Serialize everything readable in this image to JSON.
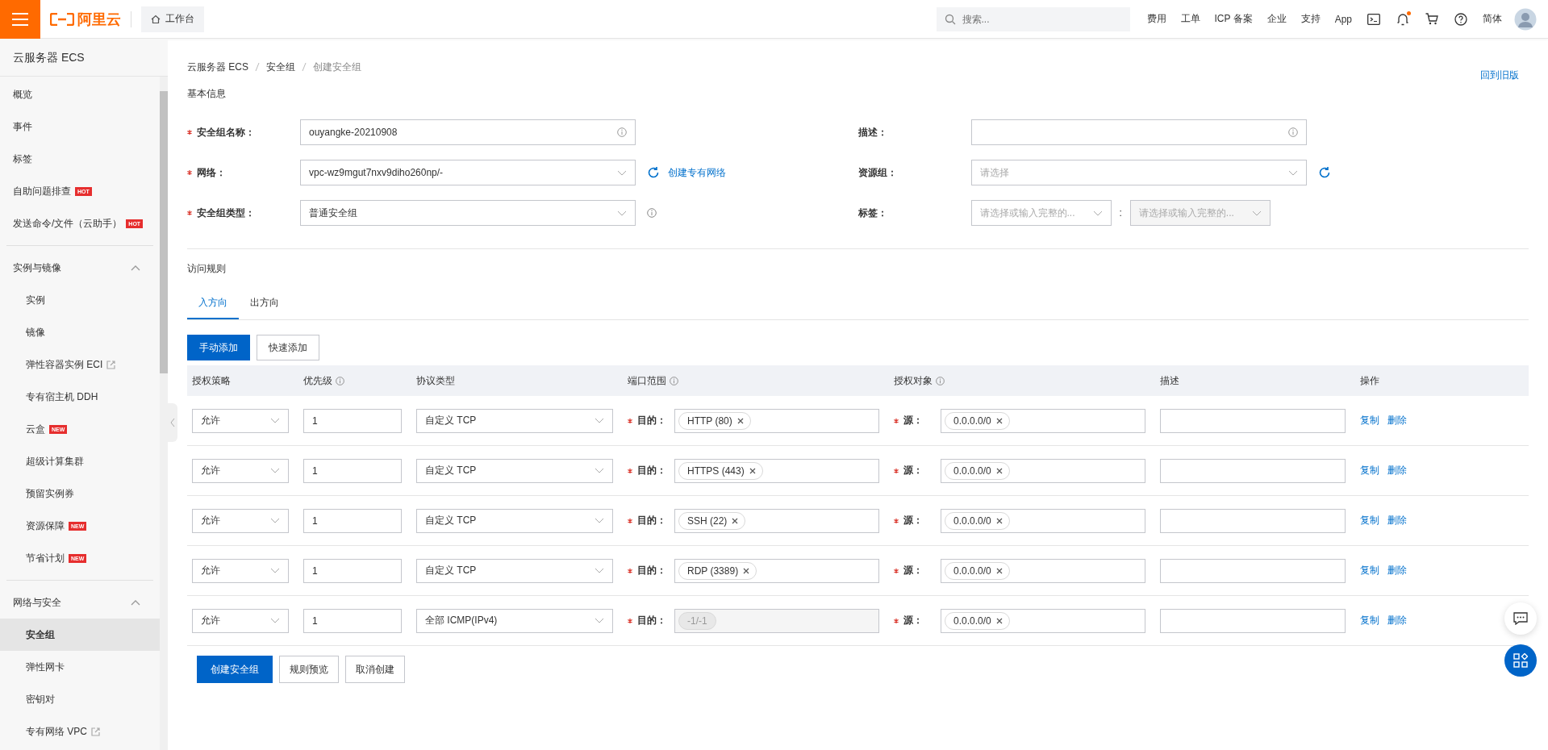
{
  "topbar": {
    "logo": "阿里云",
    "workbench": "工作台",
    "search": {
      "placeholder": "搜索..."
    },
    "links": [
      "费用",
      "工单",
      "ICP 备案",
      "企业",
      "支持",
      "App"
    ],
    "bell_unread": true,
    "language": "简体"
  },
  "sidebar": {
    "title": "云服务器 ECS",
    "items": [
      {
        "label": "概览",
        "selected": false
      },
      {
        "label": "事件",
        "selected": false
      },
      {
        "label": "标签",
        "selected": false
      },
      {
        "label": "自助问题排查",
        "badge": "HOT",
        "selected": false
      },
      {
        "label": "发送命令/文件（云助手）",
        "badge": "HOT",
        "selected": false
      }
    ],
    "groups": [
      {
        "label": "实例与镜像",
        "expanded": true,
        "items": [
          {
            "label": "实例",
            "selected": false
          },
          {
            "label": "镜像",
            "selected": false
          },
          {
            "label": "弹性容器实例 ECI",
            "external": true,
            "selected": false
          },
          {
            "label": "专有宿主机 DDH",
            "selected": false
          },
          {
            "label": "云盒",
            "badge": "NEW",
            "selected": false
          },
          {
            "label": "超级计算集群",
            "selected": false
          },
          {
            "label": "预留实例券",
            "selected": false
          },
          {
            "label": "资源保障",
            "badge": "NEW",
            "selected": false
          },
          {
            "label": "节省计划",
            "badge": "NEW",
            "selected": false
          }
        ]
      },
      {
        "label": "网络与安全",
        "expanded": true,
        "items": [
          {
            "label": "安全组",
            "selected": true
          },
          {
            "label": "弹性网卡",
            "selected": false
          },
          {
            "label": "密钥对",
            "selected": false
          },
          {
            "label": "专有网络 VPC",
            "external": true,
            "selected": false
          }
        ]
      }
    ]
  },
  "breadcrumb": [
    "云服务器 ECS",
    "安全组",
    "创建安全组"
  ],
  "old_version_link": "回到旧版",
  "basic_info": {
    "title": "基本信息",
    "left_fields": [
      {
        "kind": "text",
        "label": "安全组名称：",
        "required": true,
        "value": "ouyangke-20210908",
        "info": true
      },
      {
        "kind": "select",
        "label": "网络：",
        "required": true,
        "value": "vpc-wz9mgut7nxv9diho260np/-",
        "refresh": true,
        "link": "创建专有网络"
      },
      {
        "kind": "select",
        "label": "安全组类型：",
        "required": true,
        "value": "普通安全组",
        "info": true
      }
    ],
    "right_fields": [
      {
        "kind": "text",
        "label": "描述：",
        "required": false,
        "info": true
      },
      {
        "kind": "select",
        "label": "资源组：",
        "required": false,
        "placeholder": "请选择",
        "refresh": true
      },
      {
        "kind": "tags",
        "label": "标签：",
        "required": false,
        "key_placeholder": "请选择或输入完整的...",
        "value_placeholder": "请选择或输入完整的...",
        "separator": ":"
      }
    ]
  },
  "rules": {
    "title": "访问规则",
    "tabs": [
      {
        "label": "入方向",
        "selected": true
      },
      {
        "label": "出方向",
        "selected": false
      }
    ],
    "buttons": [
      {
        "label": "手动添加",
        "primary": true
      },
      {
        "label": "快速添加",
        "primary": false
      }
    ],
    "columns": [
      {
        "label": "授权策略",
        "info": false
      },
      {
        "label": "优先级",
        "info": true
      },
      {
        "label": "协议类型",
        "info": false
      },
      {
        "label": "端口范围",
        "info": true
      },
      {
        "label": "授权对象",
        "info": true
      },
      {
        "label": "描述",
        "info": false
      },
      {
        "label": "操作",
        "info": false
      }
    ],
    "rows": [
      {
        "policy": "允许",
        "priority": "1",
        "protocol": "自定义 TCP",
        "dest_label": "目的：",
        "dest_tag": "HTTP (80)",
        "dest_disabled": false,
        "src_label": "源：",
        "src_tag": "0.0.0.0/0",
        "actions": [
          "复制",
          "删除"
        ]
      },
      {
        "policy": "允许",
        "priority": "1",
        "protocol": "自定义 TCP",
        "dest_label": "目的：",
        "dest_tag": "HTTPS (443)",
        "dest_disabled": false,
        "src_label": "源：",
        "src_tag": "0.0.0.0/0",
        "actions": [
          "复制",
          "删除"
        ]
      },
      {
        "policy": "允许",
        "priority": "1",
        "protocol": "自定义 TCP",
        "dest_label": "目的：",
        "dest_tag": "SSH (22)",
        "dest_disabled": false,
        "src_label": "源：",
        "src_tag": "0.0.0.0/0",
        "actions": [
          "复制",
          "删除"
        ]
      },
      {
        "policy": "允许",
        "priority": "1",
        "protocol": "自定义 TCP",
        "dest_label": "目的：",
        "dest_tag": "RDP (3389)",
        "dest_disabled": false,
        "src_label": "源：",
        "src_tag": "0.0.0.0/0",
        "actions": [
          "复制",
          "删除"
        ]
      },
      {
        "policy": "允许",
        "priority": "1",
        "protocol": "全部 ICMP(IPv4)",
        "dest_label": "目的：",
        "dest_tag": "-1/-1",
        "dest_disabled": true,
        "src_label": "源：",
        "src_tag": "0.0.0.0/0",
        "actions": [
          "复制",
          "删除"
        ]
      }
    ]
  },
  "footer_buttons": [
    {
      "label": "创建安全组",
      "primary": true
    },
    {
      "label": "规则预览",
      "primary": false
    },
    {
      "label": "取消创建",
      "primary": false
    }
  ]
}
